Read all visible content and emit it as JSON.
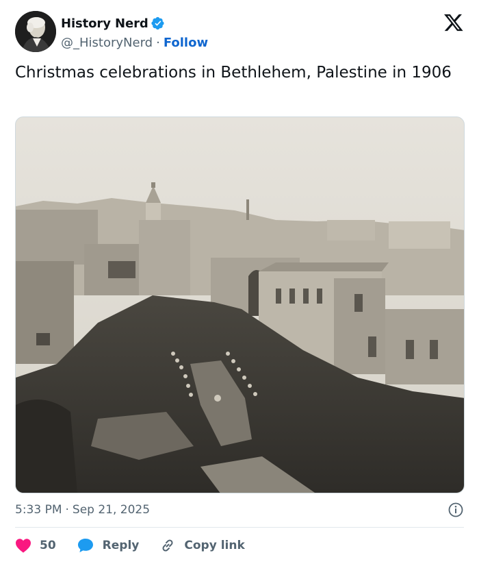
{
  "author": {
    "display_name": "History Nerd",
    "handle": "@_HistoryNerd",
    "separator": "·",
    "follow_label": "Follow",
    "verified_color": "#1d9bf0"
  },
  "tweet": {
    "text": "Christmas celebrations in Bethlehem, Palestine in 1906"
  },
  "meta": {
    "time": "5:33 PM",
    "separator": "·",
    "date": "Sep 21, 2025"
  },
  "actions": {
    "like_count": "50",
    "reply_label": "Reply",
    "copy_label": "Copy link",
    "like_color": "#f91880",
    "reply_color": "#1d9bf0"
  },
  "icons": {
    "logo": "x-logo-icon",
    "verified": "verified-badge-icon",
    "info": "info-icon",
    "like": "heart-icon",
    "reply": "speech-bubble-icon",
    "copy": "link-icon"
  }
}
